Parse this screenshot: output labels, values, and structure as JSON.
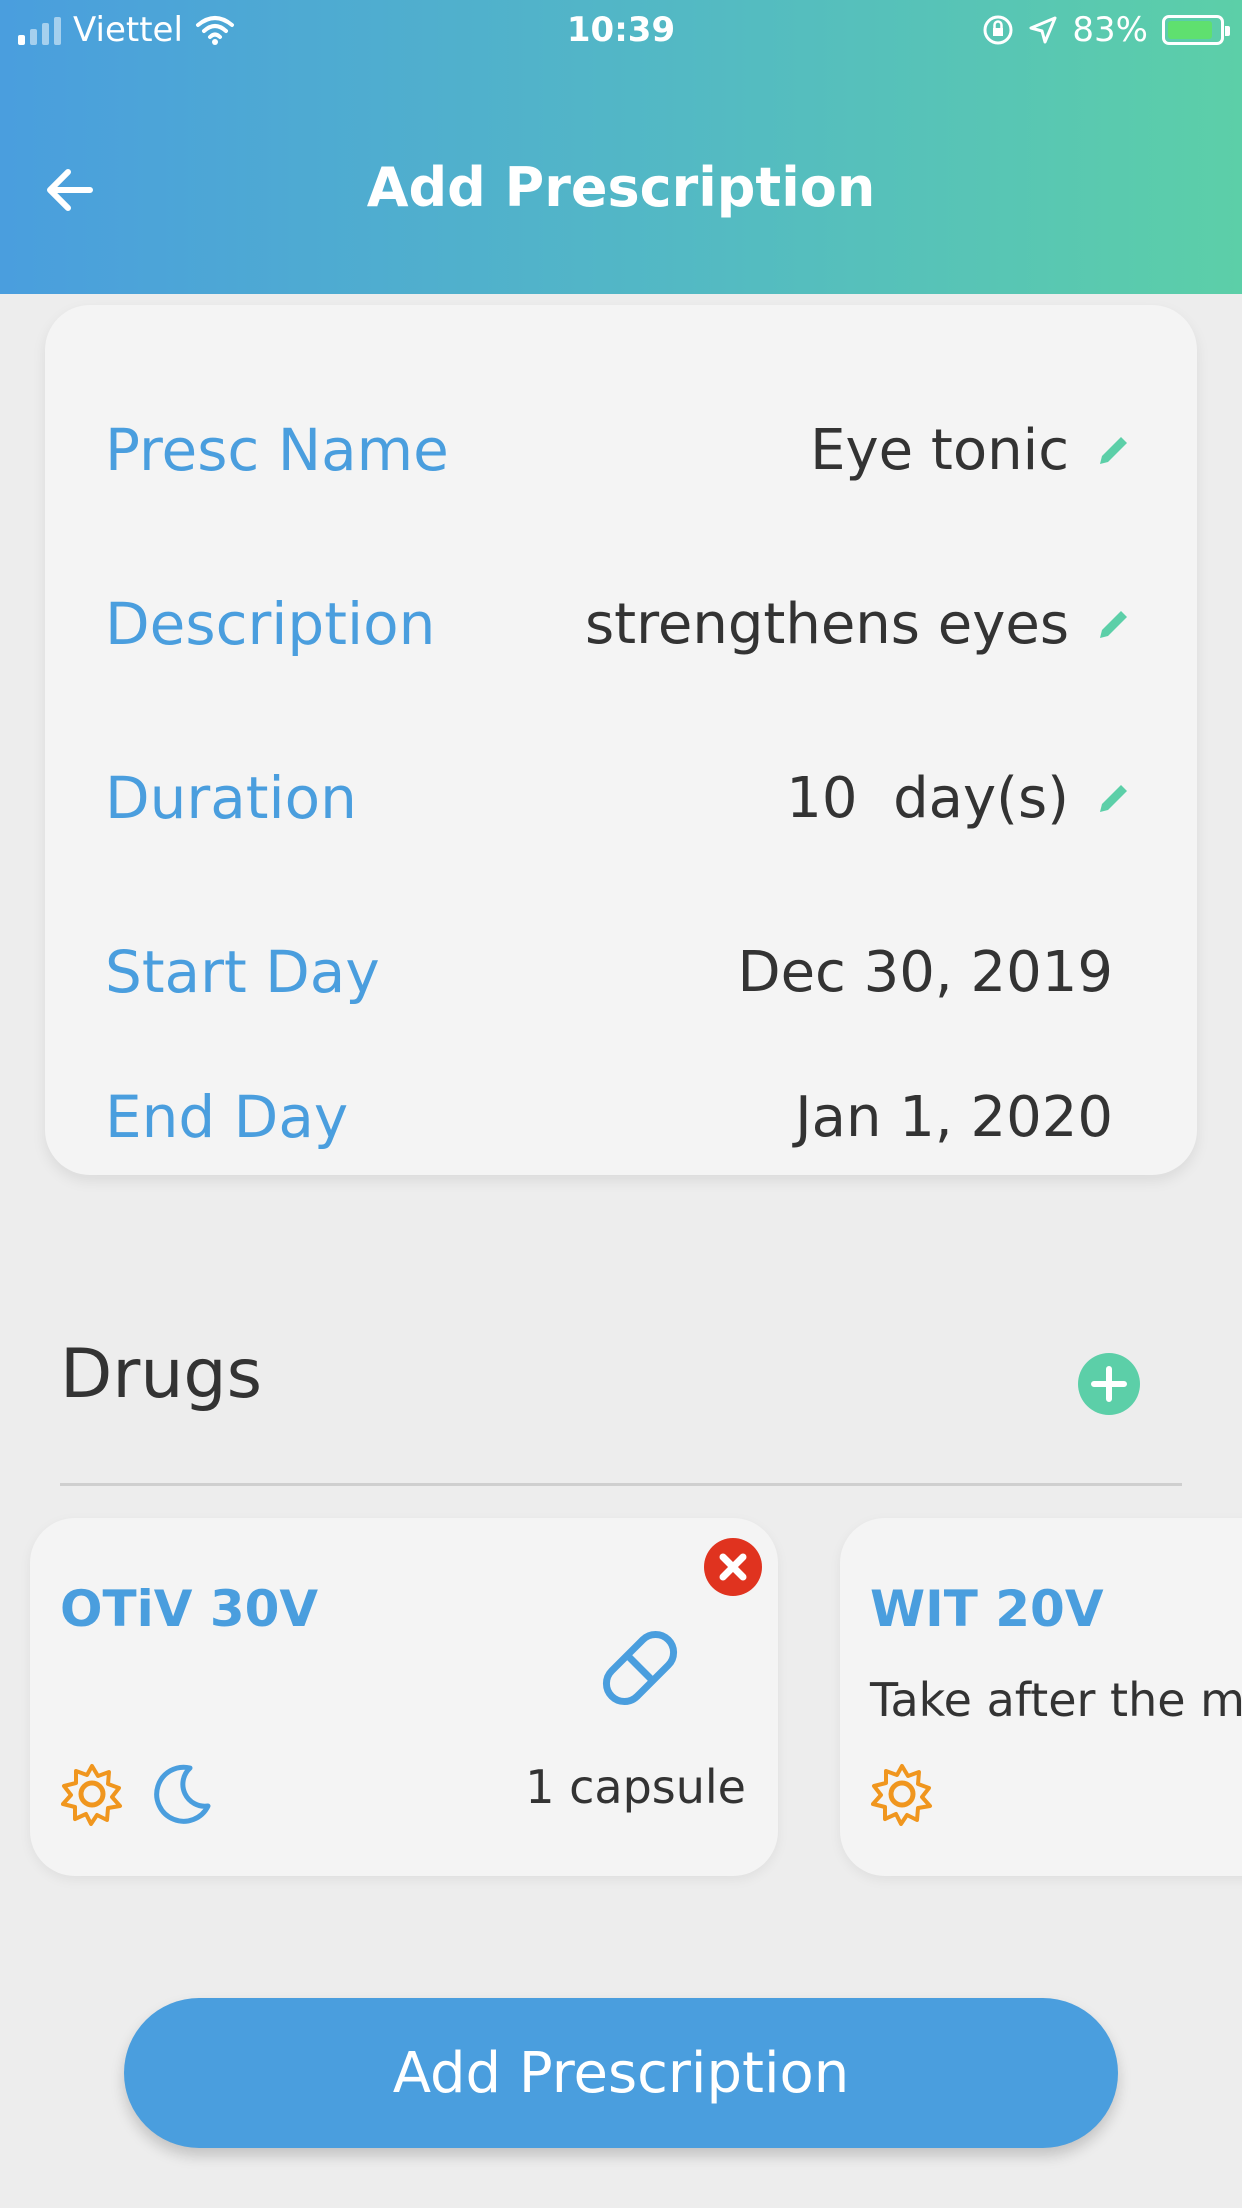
{
  "status_bar": {
    "carrier": "Viettel",
    "time": "10:39",
    "battery": "83%"
  },
  "header": {
    "title": "Add Prescription"
  },
  "prescription": {
    "rows": [
      {
        "label": "Presc Name",
        "value": "Eye tonic",
        "editable": true
      },
      {
        "label": "Description",
        "value": "strengthens eyes",
        "editable": true
      },
      {
        "label": "Duration",
        "value": "10  day(s)",
        "editable": true
      },
      {
        "label": "Start Day",
        "value": "Dec 30, 2019",
        "editable": false
      },
      {
        "label": "End Day",
        "value": "Jan 1, 2020",
        "editable": false
      }
    ]
  },
  "drugs": {
    "title": "Drugs",
    "items": [
      {
        "name": "OTiV 30V",
        "dose": "1 capsule",
        "times": [
          "sun-icon",
          "moon-icon"
        ]
      },
      {
        "name": "WIT 20V",
        "note": "Take after the me",
        "times": [
          "sun-icon"
        ]
      }
    ]
  },
  "actions": {
    "submit_label": "Add Prescription"
  },
  "colors": {
    "accent_blue": "#4a9ede",
    "accent_green": "#5ccfa8",
    "danger_red": "#e0331f",
    "sun_orange": "#f0961e"
  }
}
